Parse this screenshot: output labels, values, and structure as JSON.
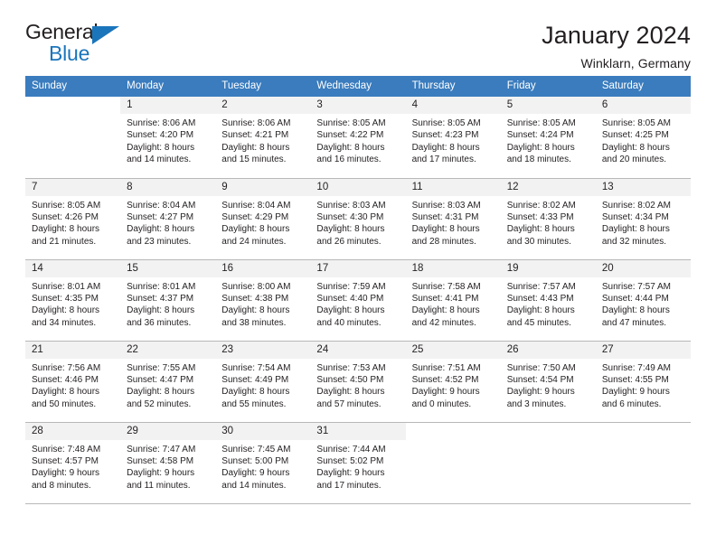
{
  "brand": {
    "name_top": "General",
    "name_bottom": "Blue",
    "accent_color": "#1b75bb",
    "logo_icon": "triangle-icon"
  },
  "header": {
    "title": "January 2024",
    "location": "Winklarn, Germany"
  },
  "calendar": {
    "header_color": "#3a7cbe",
    "daynum_band_color": "#f2f2f2",
    "row_border_color": "#b8b8b8",
    "weekday_headers": [
      "Sunday",
      "Monday",
      "Tuesday",
      "Wednesday",
      "Thursday",
      "Friday",
      "Saturday"
    ],
    "weeks": [
      [
        {
          "day": "",
          "lines": []
        },
        {
          "day": "1",
          "lines": [
            "Sunrise: 8:06 AM",
            "Sunset: 4:20 PM",
            "Daylight: 8 hours",
            "and 14 minutes."
          ]
        },
        {
          "day": "2",
          "lines": [
            "Sunrise: 8:06 AM",
            "Sunset: 4:21 PM",
            "Daylight: 8 hours",
            "and 15 minutes."
          ]
        },
        {
          "day": "3",
          "lines": [
            "Sunrise: 8:05 AM",
            "Sunset: 4:22 PM",
            "Daylight: 8 hours",
            "and 16 minutes."
          ]
        },
        {
          "day": "4",
          "lines": [
            "Sunrise: 8:05 AM",
            "Sunset: 4:23 PM",
            "Daylight: 8 hours",
            "and 17 minutes."
          ]
        },
        {
          "day": "5",
          "lines": [
            "Sunrise: 8:05 AM",
            "Sunset: 4:24 PM",
            "Daylight: 8 hours",
            "and 18 minutes."
          ]
        },
        {
          "day": "6",
          "lines": [
            "Sunrise: 8:05 AM",
            "Sunset: 4:25 PM",
            "Daylight: 8 hours",
            "and 20 minutes."
          ]
        }
      ],
      [
        {
          "day": "7",
          "lines": [
            "Sunrise: 8:05 AM",
            "Sunset: 4:26 PM",
            "Daylight: 8 hours",
            "and 21 minutes."
          ]
        },
        {
          "day": "8",
          "lines": [
            "Sunrise: 8:04 AM",
            "Sunset: 4:27 PM",
            "Daylight: 8 hours",
            "and 23 minutes."
          ]
        },
        {
          "day": "9",
          "lines": [
            "Sunrise: 8:04 AM",
            "Sunset: 4:29 PM",
            "Daylight: 8 hours",
            "and 24 minutes."
          ]
        },
        {
          "day": "10",
          "lines": [
            "Sunrise: 8:03 AM",
            "Sunset: 4:30 PM",
            "Daylight: 8 hours",
            "and 26 minutes."
          ]
        },
        {
          "day": "11",
          "lines": [
            "Sunrise: 8:03 AM",
            "Sunset: 4:31 PM",
            "Daylight: 8 hours",
            "and 28 minutes."
          ]
        },
        {
          "day": "12",
          "lines": [
            "Sunrise: 8:02 AM",
            "Sunset: 4:33 PM",
            "Daylight: 8 hours",
            "and 30 minutes."
          ]
        },
        {
          "day": "13",
          "lines": [
            "Sunrise: 8:02 AM",
            "Sunset: 4:34 PM",
            "Daylight: 8 hours",
            "and 32 minutes."
          ]
        }
      ],
      [
        {
          "day": "14",
          "lines": [
            "Sunrise: 8:01 AM",
            "Sunset: 4:35 PM",
            "Daylight: 8 hours",
            "and 34 minutes."
          ]
        },
        {
          "day": "15",
          "lines": [
            "Sunrise: 8:01 AM",
            "Sunset: 4:37 PM",
            "Daylight: 8 hours",
            "and 36 minutes."
          ]
        },
        {
          "day": "16",
          "lines": [
            "Sunrise: 8:00 AM",
            "Sunset: 4:38 PM",
            "Daylight: 8 hours",
            "and 38 minutes."
          ]
        },
        {
          "day": "17",
          "lines": [
            "Sunrise: 7:59 AM",
            "Sunset: 4:40 PM",
            "Daylight: 8 hours",
            "and 40 minutes."
          ]
        },
        {
          "day": "18",
          "lines": [
            "Sunrise: 7:58 AM",
            "Sunset: 4:41 PM",
            "Daylight: 8 hours",
            "and 42 minutes."
          ]
        },
        {
          "day": "19",
          "lines": [
            "Sunrise: 7:57 AM",
            "Sunset: 4:43 PM",
            "Daylight: 8 hours",
            "and 45 minutes."
          ]
        },
        {
          "day": "20",
          "lines": [
            "Sunrise: 7:57 AM",
            "Sunset: 4:44 PM",
            "Daylight: 8 hours",
            "and 47 minutes."
          ]
        }
      ],
      [
        {
          "day": "21",
          "lines": [
            "Sunrise: 7:56 AM",
            "Sunset: 4:46 PM",
            "Daylight: 8 hours",
            "and 50 minutes."
          ]
        },
        {
          "day": "22",
          "lines": [
            "Sunrise: 7:55 AM",
            "Sunset: 4:47 PM",
            "Daylight: 8 hours",
            "and 52 minutes."
          ]
        },
        {
          "day": "23",
          "lines": [
            "Sunrise: 7:54 AM",
            "Sunset: 4:49 PM",
            "Daylight: 8 hours",
            "and 55 minutes."
          ]
        },
        {
          "day": "24",
          "lines": [
            "Sunrise: 7:53 AM",
            "Sunset: 4:50 PM",
            "Daylight: 8 hours",
            "and 57 minutes."
          ]
        },
        {
          "day": "25",
          "lines": [
            "Sunrise: 7:51 AM",
            "Sunset: 4:52 PM",
            "Daylight: 9 hours",
            "and 0 minutes."
          ]
        },
        {
          "day": "26",
          "lines": [
            "Sunrise: 7:50 AM",
            "Sunset: 4:54 PM",
            "Daylight: 9 hours",
            "and 3 minutes."
          ]
        },
        {
          "day": "27",
          "lines": [
            "Sunrise: 7:49 AM",
            "Sunset: 4:55 PM",
            "Daylight: 9 hours",
            "and 6 minutes."
          ]
        }
      ],
      [
        {
          "day": "28",
          "lines": [
            "Sunrise: 7:48 AM",
            "Sunset: 4:57 PM",
            "Daylight: 9 hours",
            "and 8 minutes."
          ]
        },
        {
          "day": "29",
          "lines": [
            "Sunrise: 7:47 AM",
            "Sunset: 4:58 PM",
            "Daylight: 9 hours",
            "and 11 minutes."
          ]
        },
        {
          "day": "30",
          "lines": [
            "Sunrise: 7:45 AM",
            "Sunset: 5:00 PM",
            "Daylight: 9 hours",
            "and 14 minutes."
          ]
        },
        {
          "day": "31",
          "lines": [
            "Sunrise: 7:44 AM",
            "Sunset: 5:02 PM",
            "Daylight: 9 hours",
            "and 17 minutes."
          ]
        },
        {
          "day": "",
          "lines": []
        },
        {
          "day": "",
          "lines": []
        },
        {
          "day": "",
          "lines": []
        }
      ]
    ]
  }
}
